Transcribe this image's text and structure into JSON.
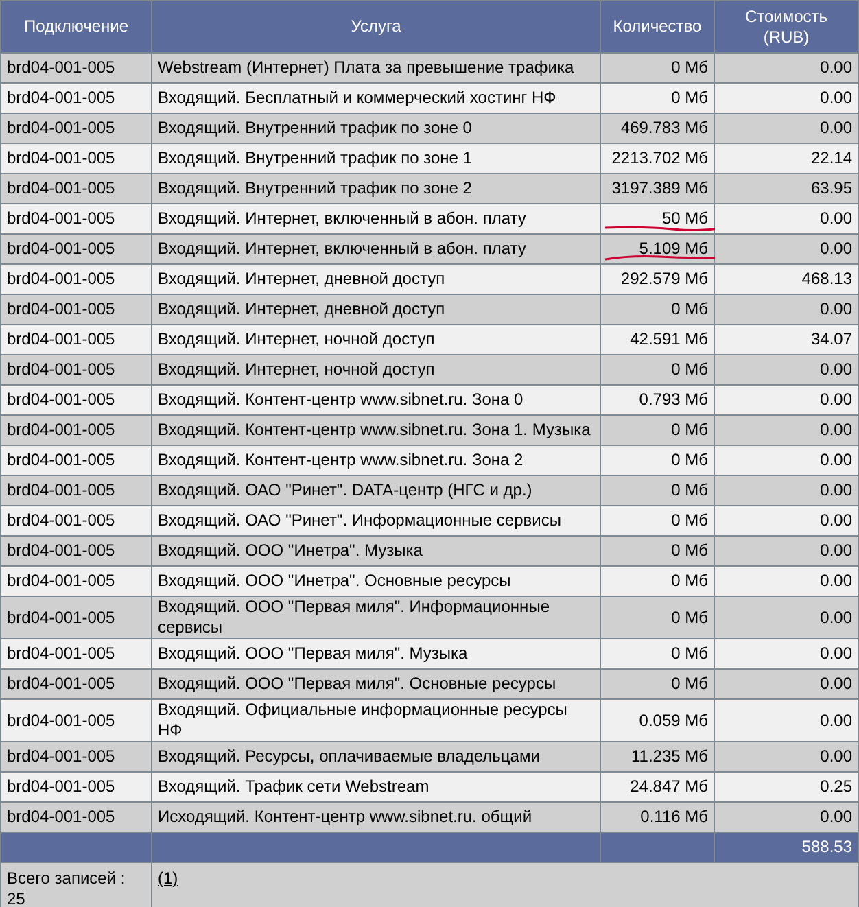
{
  "columns": [
    "Подключение",
    "Услуга",
    "Количество",
    "Стоимость (RUB)"
  ],
  "rows": [
    {
      "connection": "brd04-001-005",
      "service": "Webstream (Интернет) Плата за превышение трафика",
      "quantity": "0 Мб",
      "cost": "0.00",
      "marked": false
    },
    {
      "connection": "brd04-001-005",
      "service": "Входящий. Бесплатный и коммерческий хостинг НФ",
      "quantity": "0 Мб",
      "cost": "0.00",
      "marked": false
    },
    {
      "connection": "brd04-001-005",
      "service": "Входящий. Внутренний трафик по зоне 0",
      "quantity": "469.783 Мб",
      "cost": "0.00",
      "marked": false
    },
    {
      "connection": "brd04-001-005",
      "service": "Входящий. Внутренний трафик по зоне 1",
      "quantity": "2213.702 Мб",
      "cost": "22.14",
      "marked": false
    },
    {
      "connection": "brd04-001-005",
      "service": "Входящий. Внутренний трафик по зоне 2",
      "quantity": "3197.389 Мб",
      "cost": "63.95",
      "marked": false
    },
    {
      "connection": "brd04-001-005",
      "service": "Входящий. Интернет, включенный в абон. плату",
      "quantity": "50 Мб",
      "cost": "0.00",
      "marked": true
    },
    {
      "connection": "brd04-001-005",
      "service": "Входящий. Интернет, включенный в абон. плату",
      "quantity": "5.109 Мб",
      "cost": "0.00",
      "marked": true
    },
    {
      "connection": "brd04-001-005",
      "service": "Входящий. Интернет, дневной доступ",
      "quantity": "292.579 Мб",
      "cost": "468.13",
      "marked": false
    },
    {
      "connection": "brd04-001-005",
      "service": "Входящий. Интернет, дневной доступ",
      "quantity": "0 Мб",
      "cost": "0.00",
      "marked": false
    },
    {
      "connection": "brd04-001-005",
      "service": "Входящий. Интернет, ночной доступ",
      "quantity": "42.591 Мб",
      "cost": "34.07",
      "marked": false
    },
    {
      "connection": "brd04-001-005",
      "service": "Входящий. Интернет, ночной доступ",
      "quantity": "0 Мб",
      "cost": "0.00",
      "marked": false
    },
    {
      "connection": "brd04-001-005",
      "service": "Входящий. Контент-центр www.sibnet.ru. Зона 0",
      "quantity": "0.793 Мб",
      "cost": "0.00",
      "marked": false
    },
    {
      "connection": "brd04-001-005",
      "service": "Входящий. Контент-центр www.sibnet.ru. Зона 1. Музыка",
      "quantity": "0 Мб",
      "cost": "0.00",
      "marked": false
    },
    {
      "connection": "brd04-001-005",
      "service": "Входящий. Контент-центр www.sibnet.ru. Зона 2",
      "quantity": "0 Мб",
      "cost": "0.00",
      "marked": false
    },
    {
      "connection": "brd04-001-005",
      "service": "Входящий. ОАО \"Ринет\". DATA-центр (НГС и др.)",
      "quantity": "0 Мб",
      "cost": "0.00",
      "marked": false
    },
    {
      "connection": "brd04-001-005",
      "service": "Входящий. ОАО \"Ринет\". Информационные сервисы",
      "quantity": "0 Мб",
      "cost": "0.00",
      "marked": false
    },
    {
      "connection": "brd04-001-005",
      "service": "Входящий. ООО \"Инетра\". Музыка",
      "quantity": "0 Мб",
      "cost": "0.00",
      "marked": false
    },
    {
      "connection": "brd04-001-005",
      "service": "Входящий. ООО \"Инетра\". Основные ресурсы",
      "quantity": "0 Мб",
      "cost": "0.00",
      "marked": false
    },
    {
      "connection": "brd04-001-005",
      "service": "Входящий. ООО \"Первая миля\". Информационные сервисы",
      "quantity": "0 Мб",
      "cost": "0.00",
      "marked": false
    },
    {
      "connection": "brd04-001-005",
      "service": "Входящий. ООО \"Первая миля\". Музыка",
      "quantity": "0 Мб",
      "cost": "0.00",
      "marked": false
    },
    {
      "connection": "brd04-001-005",
      "service": "Входящий. ООО \"Первая миля\". Основные ресурсы",
      "quantity": "0 Мб",
      "cost": "0.00",
      "marked": false
    },
    {
      "connection": "brd04-001-005",
      "service": "Входящий. Официальные информационные ресурсы НФ",
      "quantity": "0.059 Мб",
      "cost": "0.00",
      "marked": false
    },
    {
      "connection": "brd04-001-005",
      "service": "Входящий. Ресурсы, оплачиваемые владельцами",
      "quantity": "11.235 Мб",
      "cost": "0.00",
      "marked": false
    },
    {
      "connection": "brd04-001-005",
      "service": "Входящий. Трафик сети Webstream",
      "quantity": "24.847 Мб",
      "cost": "0.25",
      "marked": false
    },
    {
      "connection": "brd04-001-005",
      "service": "Исходящий. Контент-центр www.sibnet.ru. общий",
      "quantity": "0.116 Мб",
      "cost": "0.00",
      "marked": false
    }
  ],
  "total": "588.53",
  "footer": {
    "records_label": "Всего записей : 25",
    "pages_link": "(1)"
  }
}
